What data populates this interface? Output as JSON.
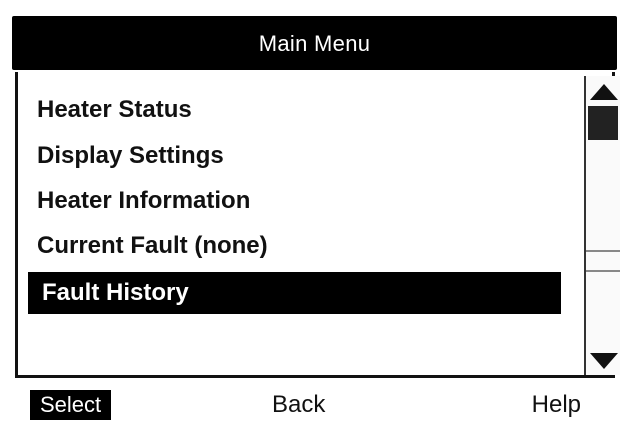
{
  "title": "Main Menu",
  "menu": {
    "items": [
      {
        "label": "Heater Status",
        "selected": false
      },
      {
        "label": "Display Settings",
        "selected": false
      },
      {
        "label": "Heater Information",
        "selected": false
      },
      {
        "label": "Current Fault (none)",
        "selected": false
      },
      {
        "label": "Fault History",
        "selected": true
      }
    ]
  },
  "scrollbar": {
    "up_icon": "triangle-up-icon",
    "down_icon": "triangle-down-icon"
  },
  "softkeys": {
    "select": "Select",
    "back": "Back",
    "help": "Help"
  },
  "colors": {
    "header_bg": "#000000",
    "header_text": "#ffffff",
    "selected_bg": "#000000",
    "selected_text": "#ffffff"
  }
}
